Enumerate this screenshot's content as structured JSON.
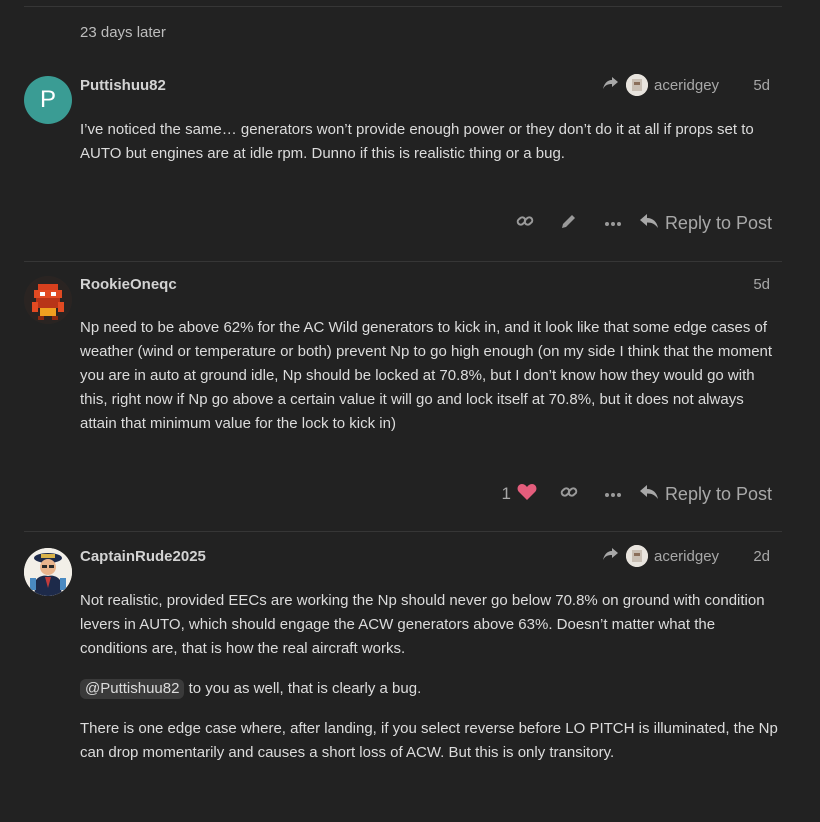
{
  "gap_label": "23 days later",
  "posts": [
    {
      "username": "Puttishuu82",
      "avatar_letter": "P",
      "reply_to_user": "aceridgey",
      "date": "5d",
      "paragraphs": [
        "I’ve noticed the same… generators won’t provide enough power or they don’t do it at all if props set to AUTO but engines are at idle rpm. Dunno if this is realistic thing or a bug."
      ],
      "reply_label": "Reply to Post"
    },
    {
      "username": "RookieOneqc",
      "date": "5d",
      "paragraphs": [
        "Np need to be above 62% for the AC Wild generators to kick in, and it look like that some edge cases of weather (wind or temperature or both) prevent Np to go high enough (on my side I think that the moment you are in auto at ground idle, Np should be locked at 70.8%, but I don’t know how they would go with this, right now if Np go above a certain value it will go and lock itself at 70.8%, but it does not always attain that minimum value for the lock to kick in)"
      ],
      "like_count": "1",
      "reply_label": "Reply to Post"
    },
    {
      "username": "CaptainRude2025",
      "reply_to_user": "aceridgey",
      "date": "2d",
      "paragraph1": "Not realistic, provided EECs are working the Np should never go below 70.8% on ground with condition levers in AUTO, which should engage the ACW generators above 63%. Doesn’t matter what the conditions are, that is how the real aircraft works.",
      "mention": "@Puttishuu82",
      "mention_tail": " to you as well, that is clearly a bug.",
      "paragraph3": "There is one edge case where, after landing, if you select reverse before LO PITCH is illuminated, the Np can drop momentarily and causes a short loss of ACW. But this is only transitory."
    }
  ],
  "icons": [
    "link-icon",
    "pencil-icon",
    "more-icon",
    "reply-arrow-icon",
    "heart-icon"
  ],
  "colors": {
    "background": "#222222",
    "avatar_teal": "#3a9c94",
    "heart": "#e45d7c"
  }
}
